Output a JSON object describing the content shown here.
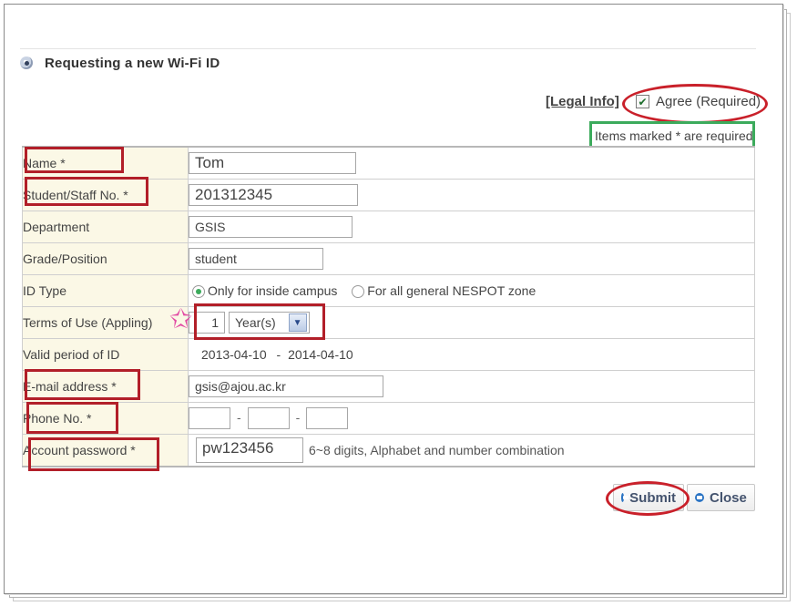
{
  "header": {
    "title": "Requesting a new Wi-Fi ID"
  },
  "legal": {
    "link_label": "[Legal Info]",
    "agree_label": "Agree (Required)",
    "agree_checked": true
  },
  "note": "Items marked * are required",
  "fields": {
    "name": {
      "label": "Name *",
      "value": "Tom"
    },
    "student_no": {
      "label": "Student/Staff No. *",
      "value": "201312345"
    },
    "department": {
      "label": "Department",
      "value": "GSIS"
    },
    "grade": {
      "label": "Grade/Position",
      "value": "student"
    },
    "id_type": {
      "label": "ID Type",
      "option1": "Only for inside campus",
      "option2": "For all general NESPOT zone",
      "selected": "Only for inside campus"
    },
    "terms": {
      "label": "Terms of Use (Appling)",
      "value": "1",
      "unit": "Year(s)"
    },
    "valid_period": {
      "label": "Valid period of ID",
      "start": "2013-04-10",
      "sep": "-",
      "end": "2014-04-10"
    },
    "email": {
      "label": "E-mail address *",
      "value": "gsis@ajou.ac.kr"
    },
    "phone": {
      "label": "Phone No. *",
      "sep": "-",
      "parts": [
        "",
        "",
        ""
      ]
    },
    "password": {
      "label": "Account password *",
      "value": "pw123456",
      "hint": "6~8 digits, Alphabet and number combination"
    }
  },
  "buttons": {
    "submit": "Submit",
    "close": "Close"
  },
  "colors": {
    "highlight_red": "#b21f29",
    "highlight_green": "#3cab5c",
    "label_bg": "#fbf8e6",
    "star": "#e24aa4"
  }
}
